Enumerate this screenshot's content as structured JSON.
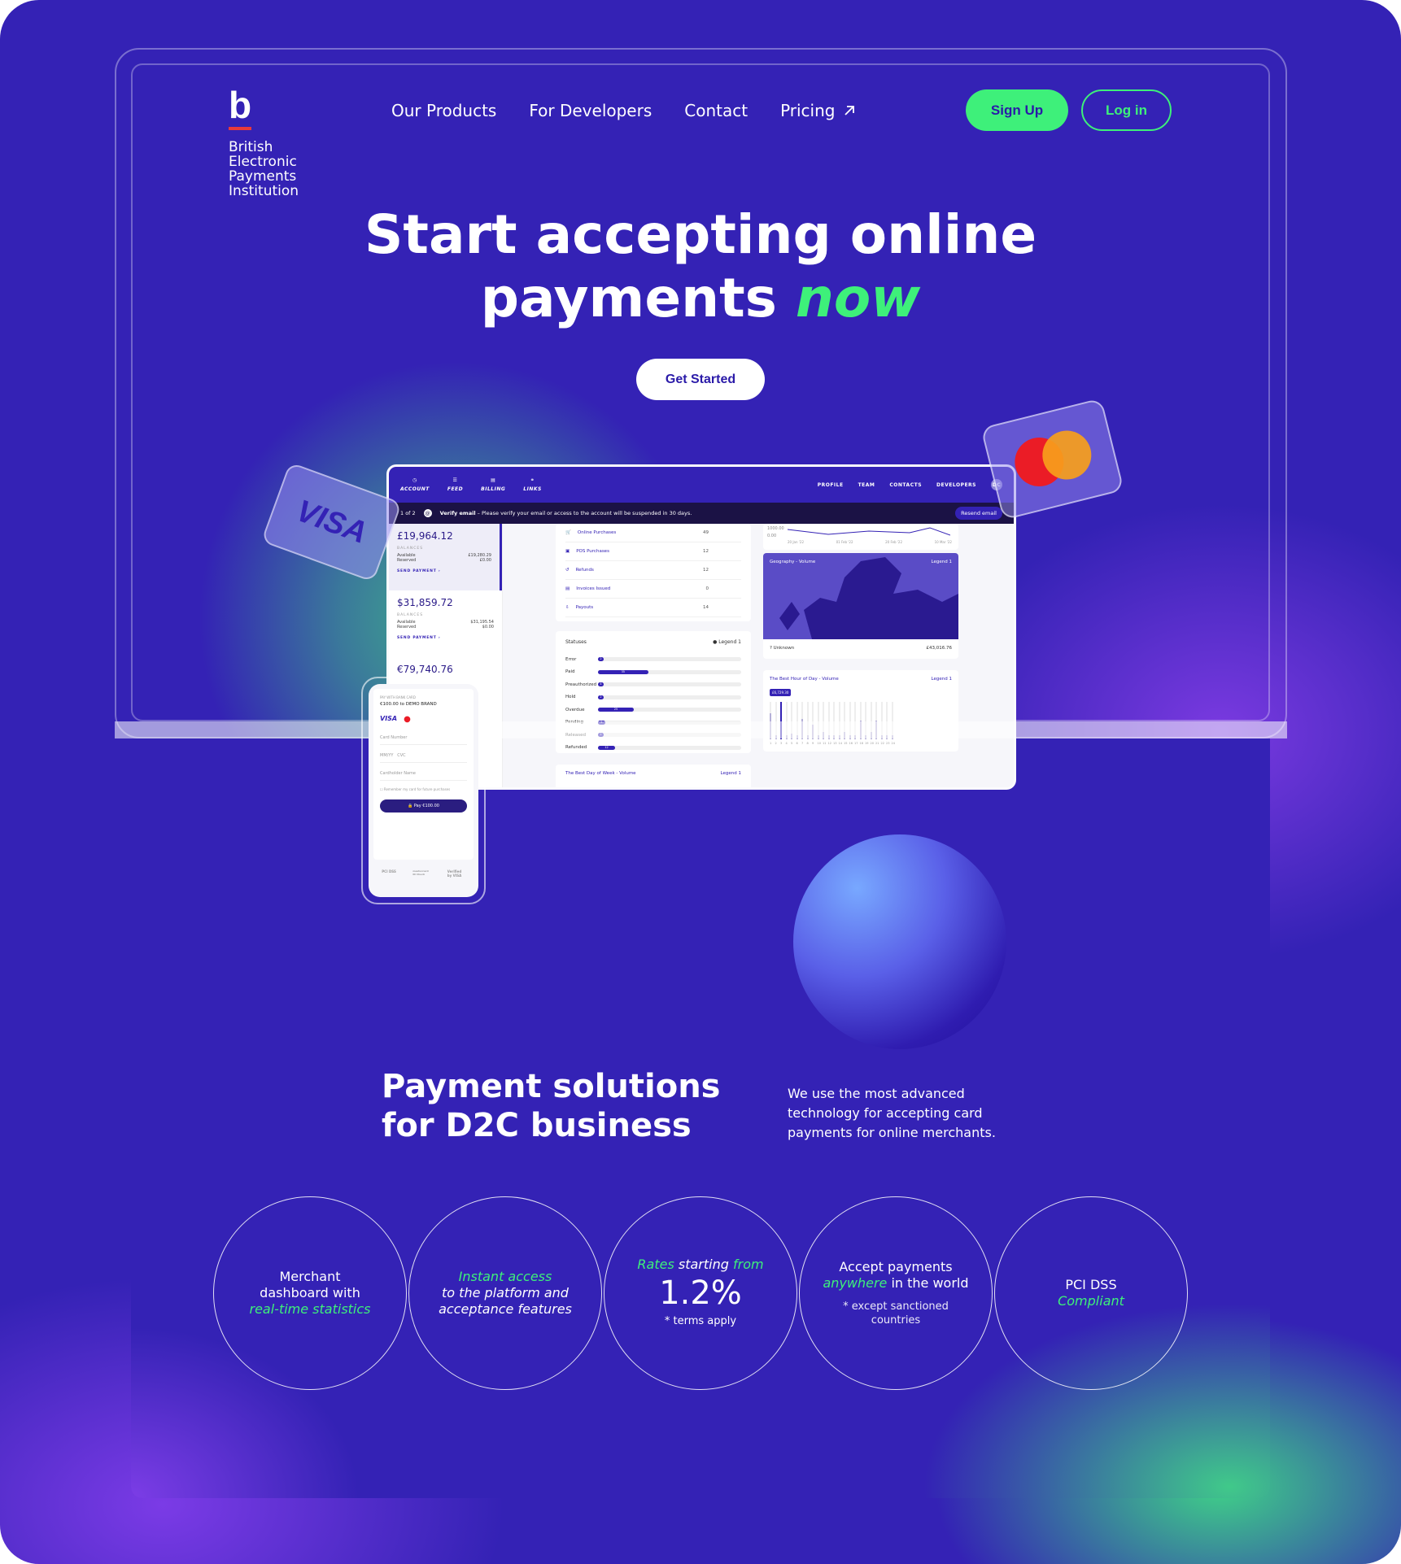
{
  "brand": {
    "letter": "b",
    "name_lines": [
      "British",
      "Electronic",
      "Payments",
      "Institution"
    ],
    "accent": "#3ef07a",
    "primary": "#3422b5",
    "logo_bar": "#e83a3a"
  },
  "nav": {
    "items": [
      "Our Products",
      "For Developers",
      "Contact",
      "Pricing"
    ],
    "pricing_icon": "arrow-up-right-icon"
  },
  "auth": {
    "signup": "Sign Up",
    "login": "Log in"
  },
  "hero": {
    "line1": "Start accepting online",
    "line2_a": "payments",
    "line2_b": "now",
    "cta": "Get Started"
  },
  "dashboard": {
    "tabs": [
      "ACCOUNT",
      "FEED",
      "BILLING",
      "LINKS"
    ],
    "right_tabs": [
      "PROFILE",
      "TEAM",
      "CONTACTS",
      "DEVELOPERS"
    ],
    "avatar": "DC",
    "verify": {
      "pager": "1 of 2",
      "title": "Verify email",
      "message": "– Please verify your email or access to the account will be suspended in 30 days.",
      "resend": "Resend email"
    },
    "accounts": [
      {
        "amount": "£19,964.12",
        "label": "BALANCES",
        "available_label": "Available",
        "available": "£19,280.29",
        "reserved_label": "Reserved",
        "reserved": "£0.00",
        "send": "SEND PAYMENT ›"
      },
      {
        "amount": "$31,859.72",
        "label": "BALANCES",
        "available_label": "Available",
        "available": "$31,195.54",
        "reserved_label": "Reserved",
        "reserved": "$0.00",
        "send": "SEND PAYMENT ›"
      },
      {
        "amount": "€79,740.76"
      }
    ],
    "transactions": [
      {
        "label": "Online Purchases",
        "value": "49"
      },
      {
        "label": "POS Purchases",
        "value": "12"
      },
      {
        "label": "Refunds",
        "value": "12"
      },
      {
        "label": "Invoices Issued",
        "value": "0"
      },
      {
        "label": "Payouts",
        "value": "14"
      }
    ],
    "line_chart": {
      "y_ticks": [
        "1000.00",
        "0.00"
      ],
      "x_ticks": [
        "20 Jan '22",
        "01 Feb '22",
        "20 Feb '22",
        "10 Mar '22"
      ]
    },
    "statuses": {
      "title": "Statuses",
      "legend": "Legend 1",
      "items": [
        {
          "label": "Error",
          "value": 2
        },
        {
          "label": "Paid",
          "value": 35
        },
        {
          "label": "Preauthorized",
          "value": 4
        },
        {
          "label": "Hold",
          "value": 2
        },
        {
          "label": "Overdue",
          "value": 25
        },
        {
          "label": "Pending",
          "value": 5
        },
        {
          "label": "Released",
          "value": 2
        },
        {
          "label": "Refunded",
          "value": 12
        }
      ],
      "max": 100
    },
    "geo": {
      "title": "Geography - Volume",
      "legend": "Legend 1",
      "unknown": "Unknown",
      "unknown_value": "£43,016.76"
    },
    "hour": {
      "title": "The Best Hour of Day - Volume",
      "legend": "Legend 1",
      "tag": "£6,729.30",
      "values": [
        0.7,
        0.1,
        1,
        0.1,
        0.15,
        0.1,
        0.55,
        0.1,
        0.4,
        0.1,
        0.2,
        0.1,
        0.1,
        0.1,
        0.2,
        0.1,
        0.1,
        0.5,
        0.1,
        0.2,
        0.5,
        0.1,
        0.1,
        0.1
      ],
      "labels": [
        "1",
        "2",
        "3",
        "4",
        "5",
        "6",
        "7",
        "8",
        "9",
        "10",
        "11",
        "12",
        "13",
        "14",
        "15",
        "16",
        "17",
        "18",
        "19",
        "20",
        "21",
        "22",
        "23",
        "24"
      ]
    },
    "week": {
      "title": "The Best Day of Week - Volume",
      "legend": "Legend 1"
    }
  },
  "phone": {
    "label": "PAY WITH BANK CARD",
    "title": "€100.00 to DEMO BRAND",
    "card_number": "Card Number",
    "expiry": "MM/YY",
    "cvc": "CVC",
    "holder": "Cardholder Name",
    "remember": "Remember my card for future purchases",
    "pay": "Pay €100.00",
    "logos": [
      "PCI DSS",
      "mastercard ID Check",
      "Verified by VISA"
    ]
  },
  "cards": {
    "visa": "VISA"
  },
  "solutions": {
    "title_1": "Payment solutions",
    "title_2": "for D2C business",
    "desc": "We use the most advanced technology for accepting card payments for online merchants."
  },
  "features": [
    {
      "a": "Merchant",
      "b": "dashboard with",
      "c": "real-time statistics"
    },
    {
      "a": "Instant access",
      "b": "to the platform and",
      "c": "acceptance features"
    },
    {
      "a": "Rates",
      "b": "starting",
      "c": "from",
      "big": "1.2%",
      "note": "* terms apply"
    },
    {
      "a": "Accept payments",
      "b": "anywhere",
      "c": "in the world",
      "note": "* except sanctioned countries"
    },
    {
      "a": "PCI DSS",
      "b": "Compliant"
    }
  ]
}
